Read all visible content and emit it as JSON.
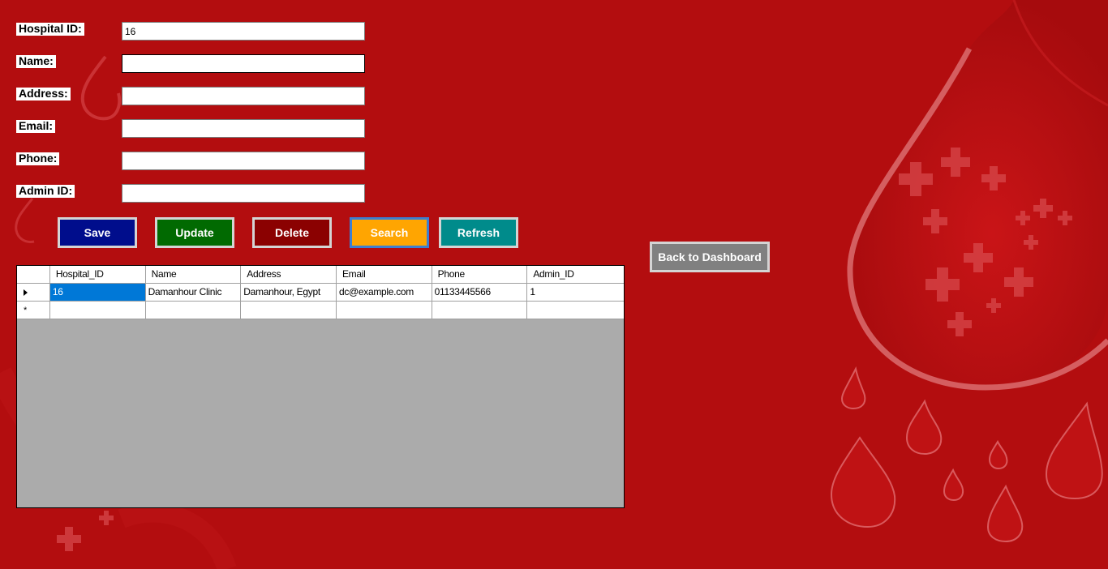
{
  "form": {
    "hospital_id": {
      "label": "Hospital ID:",
      "value": "16"
    },
    "name": {
      "label": "Name:",
      "value": ""
    },
    "address": {
      "label": "Address:",
      "value": ""
    },
    "email": {
      "label": "Email:",
      "value": ""
    },
    "phone": {
      "label": "Phone:",
      "value": ""
    },
    "admin_id": {
      "label": "Admin ID:",
      "value": ""
    }
  },
  "buttons": {
    "save": "Save",
    "update": "Update",
    "delete": "Delete",
    "search": "Search",
    "refresh": "Refresh",
    "back": "Back to Dashboard"
  },
  "colors": {
    "background": "#b30d0f",
    "save": "#000d8c",
    "update": "#016a01",
    "delete": "#8b0101",
    "search": "#ffa501",
    "refresh": "#008b8b",
    "back": "#808080",
    "selected_cell": "#0078d7"
  },
  "grid": {
    "columns": [
      "Hospital_ID",
      "Name",
      "Address",
      "Email",
      "Phone",
      "Admin_ID"
    ],
    "rows": [
      [
        "16",
        "Damanhour Clinic",
        "Damanhour, Egypt",
        "dc@example.com",
        "01133445566",
        "1"
      ]
    ],
    "current_row_indicator": "triangle-right-icon",
    "new_row_indicator": "*"
  }
}
